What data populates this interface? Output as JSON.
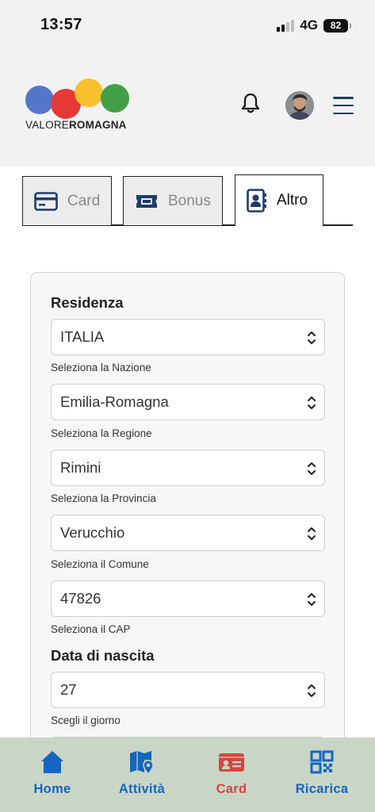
{
  "status_bar": {
    "time": "13:57",
    "network": "4G",
    "battery": "82"
  },
  "header": {
    "logo_word1": "VALORE",
    "logo_word2": "ROMAGNA",
    "bell_icon": "bell-icon",
    "menu_icon": "hamburger-menu-icon"
  },
  "tabs": [
    {
      "label": "Card",
      "icon": "credit-card-icon",
      "active": false
    },
    {
      "label": "Bonus",
      "icon": "ticket-icon",
      "active": false
    },
    {
      "label": "Altro",
      "icon": "contact-book-icon",
      "active": true
    }
  ],
  "form": {
    "residenza_title": "Residenza",
    "nazione": {
      "value": "ITALIA",
      "hint": "Seleziona la Nazione"
    },
    "regione": {
      "value": "Emilia-Romagna",
      "hint": "Seleziona la Regione"
    },
    "provincia": {
      "value": "Rimini",
      "hint": "Seleziona la Provincia"
    },
    "comune": {
      "value": "Verucchio",
      "hint": "Seleziona il Comune"
    },
    "cap": {
      "value": "47826",
      "hint": "Seleziona il CAP"
    },
    "nascita_title": "Data di nascita",
    "giorno": {
      "value": "27",
      "hint": "Scegli il giorno"
    }
  },
  "bottom_nav": [
    {
      "label": "Home",
      "icon": "home-icon",
      "active": false
    },
    {
      "label": "Attività",
      "icon": "map-pin-icon",
      "active": false
    },
    {
      "label": "Card",
      "icon": "id-card-icon",
      "active": true
    },
    {
      "label": "Ricarica",
      "icon": "qr-code-icon",
      "active": false
    }
  ],
  "colors": {
    "nav_blue": "#1565c0",
    "nav_active_red": "#d64541",
    "icon_navy": "#1d3c6e",
    "logo_blue": "#4a6fc7",
    "logo_red": "#e53935",
    "logo_yellow": "#fbc02d",
    "logo_green": "#43a047"
  }
}
